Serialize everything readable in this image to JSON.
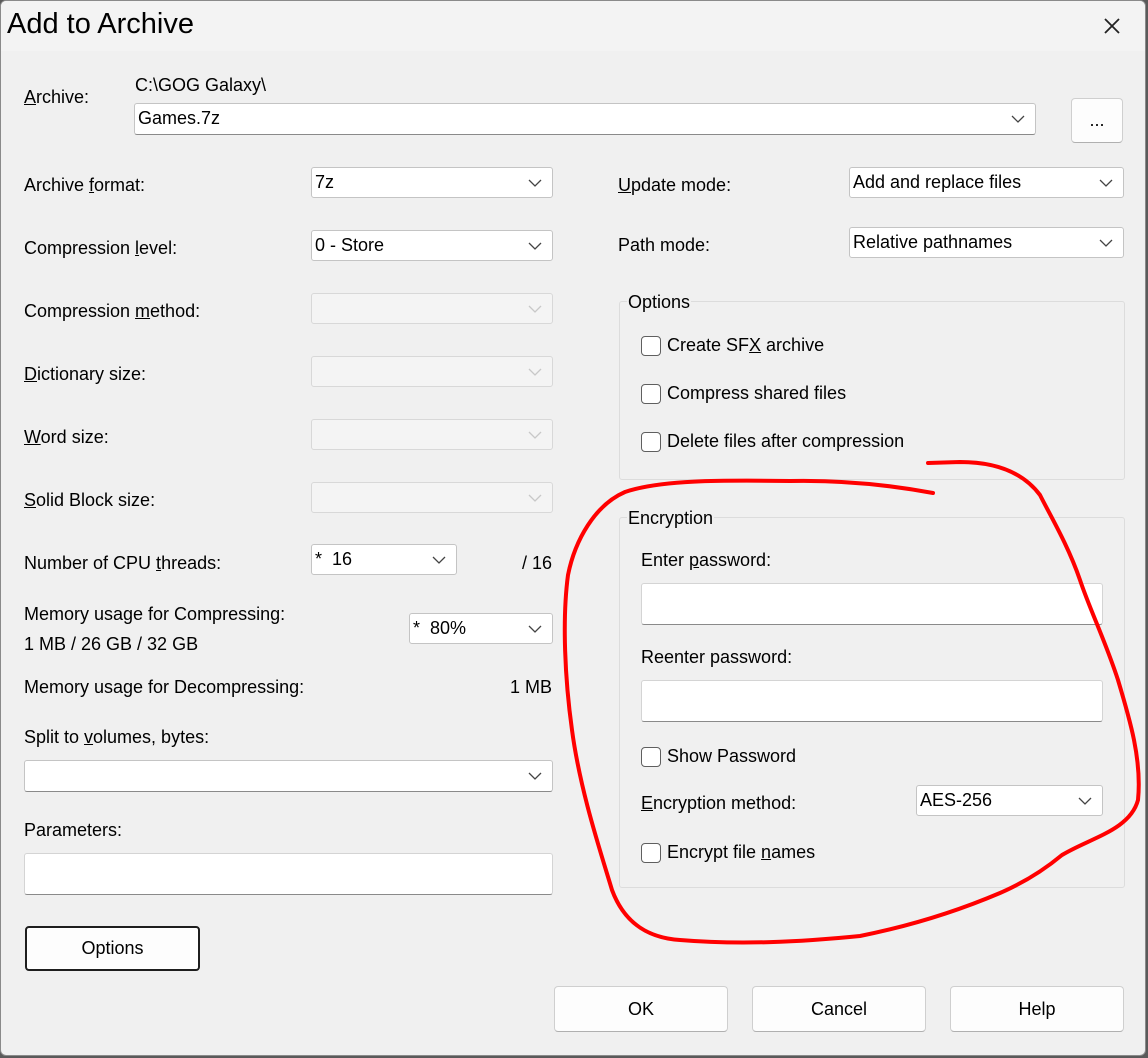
{
  "window": {
    "title": "Add to Archive",
    "close_icon": "close-icon"
  },
  "archive": {
    "label_prefix": "",
    "label_accel": "A",
    "label_rest": "rchive:",
    "path": "C:\\GOG Galaxy\\",
    "name": "Games.7z",
    "browse_label": "..."
  },
  "left": {
    "archive_format": {
      "label_a": "Archive ",
      "label_accel": "f",
      "label_b": "ormat:",
      "value": "7z"
    },
    "compression_level": {
      "label_a": "Compression ",
      "label_accel": "l",
      "label_b": "evel:",
      "value": "0 - Store"
    },
    "compression_method": {
      "label_a": "Compression ",
      "label_accel": "m",
      "label_b": "ethod:",
      "value": ""
    },
    "dictionary_size": {
      "label_a": "",
      "label_accel": "D",
      "label_b": "ictionary size:",
      "value": ""
    },
    "word_size": {
      "label_a": "",
      "label_accel": "W",
      "label_b": "ord size:",
      "value": ""
    },
    "solid_block_size": {
      "label_a": "",
      "label_accel": "S",
      "label_b": "olid Block size:",
      "value": ""
    },
    "cpu_threads": {
      "label_a": "Number of CPU ",
      "label_accel": "t",
      "label_b": "hreads:",
      "value": "*  16",
      "max": "/ 16"
    },
    "memory_compress": {
      "label": "Memory usage for Compressing:",
      "detail": "1 MB / 26 GB / 32 GB",
      "value": "*  80%"
    },
    "memory_decompress": {
      "label": "Memory usage for Decompressing:",
      "value": "1 MB"
    },
    "split_volumes": {
      "label_a": "Split to ",
      "label_accel": "v",
      "label_b": "olumes, bytes:",
      "value": ""
    },
    "parameters": {
      "label": "Parameters:",
      "value": ""
    },
    "options_button": "Options"
  },
  "right": {
    "update_mode": {
      "label_a": "",
      "label_accel": "U",
      "label_b": "pdate mode:",
      "value": "Add and replace files"
    },
    "path_mode": {
      "label": "Path mode:",
      "value": "Relative pathnames"
    },
    "options_group": {
      "title": "Options",
      "sfx": {
        "label_a": "Create SF",
        "label_accel": "X",
        "label_b": " archive",
        "checked": false
      },
      "shared": {
        "label": "Compress shared files",
        "checked": false
      },
      "delete": {
        "label": "Delete files after compression",
        "checked": false
      }
    },
    "encryption_group": {
      "title": "Encryption",
      "enter_password": {
        "label_a": "Enter ",
        "label_accel": "p",
        "label_b": "assword:",
        "value": ""
      },
      "reenter_password": {
        "label": "Reenter password:",
        "value": ""
      },
      "show_password": {
        "label": "Show Password",
        "checked": false
      },
      "method": {
        "label_a": "",
        "label_accel": "E",
        "label_b": "ncryption method:",
        "value": "AES-256"
      },
      "encrypt_names": {
        "label_a": "Encrypt file ",
        "label_accel": "n",
        "label_b": "ames",
        "checked": false
      }
    }
  },
  "buttons": {
    "ok": "OK",
    "cancel": "Cancel",
    "help": "Help"
  },
  "annotation": {
    "color": "#ff0000",
    "shape": "hand-drawn circle"
  },
  "icons": {
    "dropdown": "chevron-down-icon",
    "checkbox": "checkbox-icon"
  }
}
